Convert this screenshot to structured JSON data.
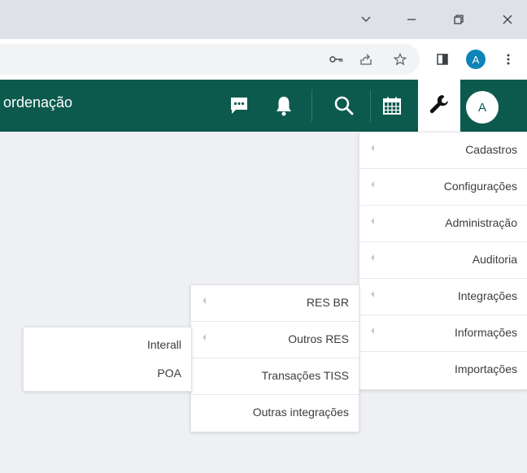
{
  "browser": {
    "window_controls": {
      "chevron": "chevron-down-icon",
      "minimize": "minimize-icon",
      "restore": "restore-icon",
      "close": "close-icon"
    },
    "toolbar_icons": [
      "key-icon",
      "share-icon",
      "star-icon",
      "sidepanel-icon"
    ],
    "profile_initial": "A"
  },
  "header": {
    "title": "ordenação",
    "icons": [
      "chat-icon",
      "bell-icon",
      "search-icon",
      "calendar-icon",
      "wrench-icon"
    ],
    "avatar_initial": "A",
    "bg_color": "#0c5a4e"
  },
  "main_menu": {
    "items": [
      {
        "label": "Cadastros",
        "has_submenu": true
      },
      {
        "label": "Configurações",
        "has_submenu": true
      },
      {
        "label": "Administração",
        "has_submenu": true
      },
      {
        "label": "Auditoria",
        "has_submenu": true
      },
      {
        "label": "Integrações",
        "has_submenu": true
      },
      {
        "label": "Informações",
        "has_submenu": true
      },
      {
        "label": "Importações",
        "has_submenu": false
      }
    ]
  },
  "integracoes_menu": {
    "items": [
      {
        "label": "RES BR",
        "has_submenu": true
      },
      {
        "label": "Outros RES",
        "has_submenu": true
      },
      {
        "label": "Transações TISS",
        "has_submenu": false
      },
      {
        "label": "Outras integrações",
        "has_submenu": false
      }
    ]
  },
  "outros_res_menu": {
    "items": [
      {
        "label": "Interall"
      },
      {
        "label": "POA"
      }
    ]
  }
}
